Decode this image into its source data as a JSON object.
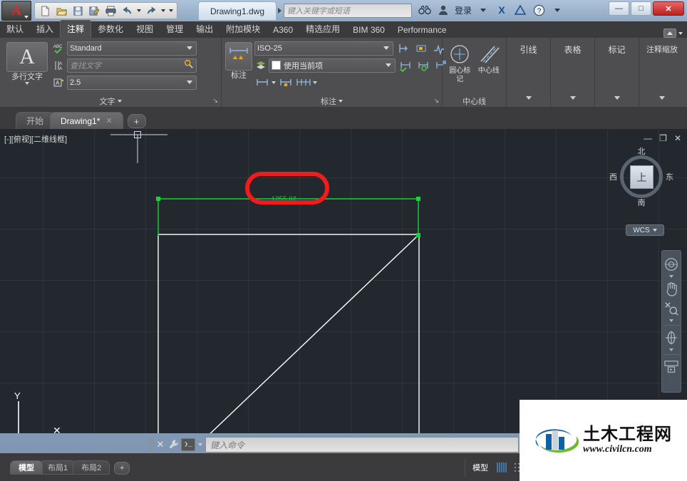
{
  "titlebar": {
    "app_menu": "A",
    "quick_access": [
      {
        "name": "new-file-icon",
        "glyph": "▧"
      },
      {
        "name": "open-file-icon",
        "glyph": "📂"
      },
      {
        "name": "save-icon",
        "glyph": "💾"
      },
      {
        "name": "save-as-icon",
        "glyph": "📝"
      },
      {
        "name": "plot-icon",
        "glyph": "🖨"
      },
      {
        "name": "undo-icon",
        "glyph": "↶"
      },
      {
        "name": "redo-icon",
        "glyph": "↷"
      }
    ],
    "document_title": "Drawing1.dwg",
    "search_placeholder": "键入关键字或短语",
    "binoculars_icon": "🔍",
    "user_icon": "👤",
    "sign_in": "登录",
    "exchange_icon": "X",
    "autodesk_icon": "△",
    "help_icon": "?",
    "window_min": "—",
    "window_max": "□",
    "window_close": "✕"
  },
  "ribbon_tabs": [
    {
      "label": "默认",
      "active": false
    },
    {
      "label": "插入",
      "active": false
    },
    {
      "label": "注释",
      "active": true
    },
    {
      "label": "参数化",
      "active": false
    },
    {
      "label": "视图",
      "active": false
    },
    {
      "label": "管理",
      "active": false
    },
    {
      "label": "输出",
      "active": false
    },
    {
      "label": "附加模块",
      "active": false
    },
    {
      "label": "A360",
      "active": false
    },
    {
      "label": "精选应用",
      "active": false
    },
    {
      "label": "BIM 360",
      "active": false
    },
    {
      "label": "Performance",
      "active": false
    }
  ],
  "panels": {
    "text": {
      "title": "文字",
      "big_button": {
        "label": "多行文字",
        "icon": "A"
      },
      "style_value": "Standard",
      "find_placeholder": "查找文字",
      "height_value": "2.5",
      "style_icon": "ABC",
      "find_icon": "A",
      "height_icon": "A"
    },
    "dimension": {
      "title": "标注",
      "big_button": {
        "label": "标注"
      },
      "style_value": "ISO-25",
      "layer_value": "使用当前项"
    },
    "centerline": {
      "title": "中心线",
      "center_mark": "圆心标记",
      "centerline": "中心线"
    },
    "others": [
      {
        "label": "引线"
      },
      {
        "label": "表格"
      },
      {
        "label": "标记"
      },
      {
        "label": "注释缩放"
      }
    ]
  },
  "file_tabs": [
    {
      "label": "开始",
      "active": false,
      "closable": false
    },
    {
      "label": "Drawing1*",
      "active": true,
      "closable": true
    }
  ],
  "file_tab_add": "+",
  "canvas": {
    "viewport_label": "[-][俯视][二维线框]",
    "win_min": "—",
    "win_max": "❐",
    "win_close": "✕",
    "dimension_text": "1255.02",
    "dimension_color": "#18d43a",
    "annotation_color": "#ef1c1c",
    "geometry_color": "#ffffff",
    "background_color": "#23282e",
    "ucs_x_label": "X",
    "ucs_y_label": "Y"
  },
  "viewcube": {
    "top": "上",
    "north": "北",
    "south": "南",
    "west": "西",
    "east": "东",
    "wcs_label": "WCS"
  },
  "navbar": [
    {
      "name": "steering-wheel-icon",
      "glyph": "◎"
    },
    {
      "name": "pan-hand-icon",
      "glyph": "✋"
    },
    {
      "name": "zoom-icon",
      "glyph": "🔍"
    },
    {
      "name": "orbit-icon",
      "glyph": "⬡"
    },
    {
      "name": "showmotion-icon",
      "glyph": "▶"
    }
  ],
  "command_line": {
    "placeholder": "键入命令",
    "close_icon": "✕",
    "settings_icon": "🔧",
    "prompt_icon": "❯_"
  },
  "layout_tabs": [
    {
      "label": "模型",
      "active": true
    },
    {
      "label": "布局1",
      "active": false
    },
    {
      "label": "布局2",
      "active": false
    }
  ],
  "layout_tab_add": "+",
  "status_bar": {
    "model_label": "模型",
    "toggles": [
      {
        "name": "grid-display-toggle",
        "glyph": "▓",
        "on": true
      },
      {
        "name": "snap-mode-toggle",
        "glyph": "∷",
        "on": false
      },
      {
        "name": "ortho-mode-toggle",
        "glyph": "∟",
        "on": false
      },
      {
        "name": "polar-tracking-toggle",
        "glyph": "◔",
        "on": false
      },
      {
        "name": "object-snap-toggle",
        "glyph": "✕",
        "on": false
      },
      {
        "name": "osnap-tracking-toggle",
        "glyph": "∠",
        "on": true
      },
      {
        "name": "ucs-icon-toggle",
        "glyph": "▣",
        "on": true
      },
      {
        "name": "dynamic-input-toggle",
        "glyph": "⚑",
        "on": true
      },
      {
        "name": "lineweight-toggle",
        "glyph": "⤨",
        "on": false
      }
    ]
  },
  "watermark": {
    "chinese": "土木工程网",
    "url": "www.civilcn.com",
    "green": "#6fba2c",
    "blue": "#1060a8"
  }
}
